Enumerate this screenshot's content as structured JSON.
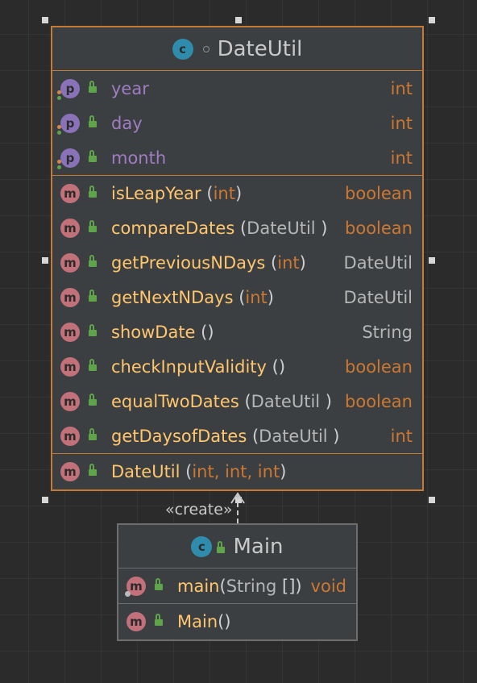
{
  "colors": {
    "background": "#2b2b2b",
    "class_fill": "#3c3f41",
    "selected_border": "#c57a35",
    "border": "#6e6e6e",
    "method_name": "#ffc66d",
    "field_name": "#9f7dc2",
    "keyword": "#cc7832"
  },
  "classes": [
    {
      "name": "DateUtil",
      "kind_icon": "class-icon",
      "fields": [
        {
          "name": "year",
          "type": "int"
        },
        {
          "name": "day",
          "type": "int"
        },
        {
          "name": "month",
          "type": "int"
        }
      ],
      "methods": [
        {
          "name": "isLeapYear",
          "open": " (",
          "params": "int",
          "close": ")",
          "return_type": "boolean"
        },
        {
          "name": "compareDates",
          "open": " (",
          "params": "DateUtil",
          "close": " )",
          "return_type": "boolean"
        },
        {
          "name": "getPreviousNDays",
          "open": " (",
          "params": "int",
          "close": ")",
          "return_type": "DateUtil"
        },
        {
          "name": "getNextNDays",
          "open": " (",
          "params": "int",
          "close": ")",
          "return_type": "DateUtil"
        },
        {
          "name": "showDate",
          "open": " ()",
          "params": "",
          "close": "",
          "return_type": "String"
        },
        {
          "name": "checkInputValidity",
          "open": " ()",
          "params": "",
          "close": "",
          "return_type": "boolean"
        },
        {
          "name": "equalTwoDates",
          "open": " (",
          "params": "DateUtil",
          "close": " )",
          "return_type": "boolean"
        },
        {
          "name": "getDaysofDates",
          "open": " (",
          "params": "DateUtil",
          "close": " )",
          "return_type": "int"
        }
      ],
      "constructors": [
        {
          "name": "DateUtil",
          "open": " (",
          "params": "int, int, int",
          "close": ")"
        }
      ]
    },
    {
      "name": "Main",
      "kind_icon": "class-icon",
      "methods": [
        {
          "name": "main",
          "open": "(",
          "params": "String",
          "close": " [])",
          "return_type": "void"
        }
      ],
      "constructors": [
        {
          "name": "Main",
          "open": "()",
          "params": "",
          "close": ""
        }
      ]
    }
  ],
  "relations": [
    {
      "from": "Main",
      "to": "DateUtil",
      "label": "«create»",
      "style": "dashed-arrow"
    }
  ]
}
